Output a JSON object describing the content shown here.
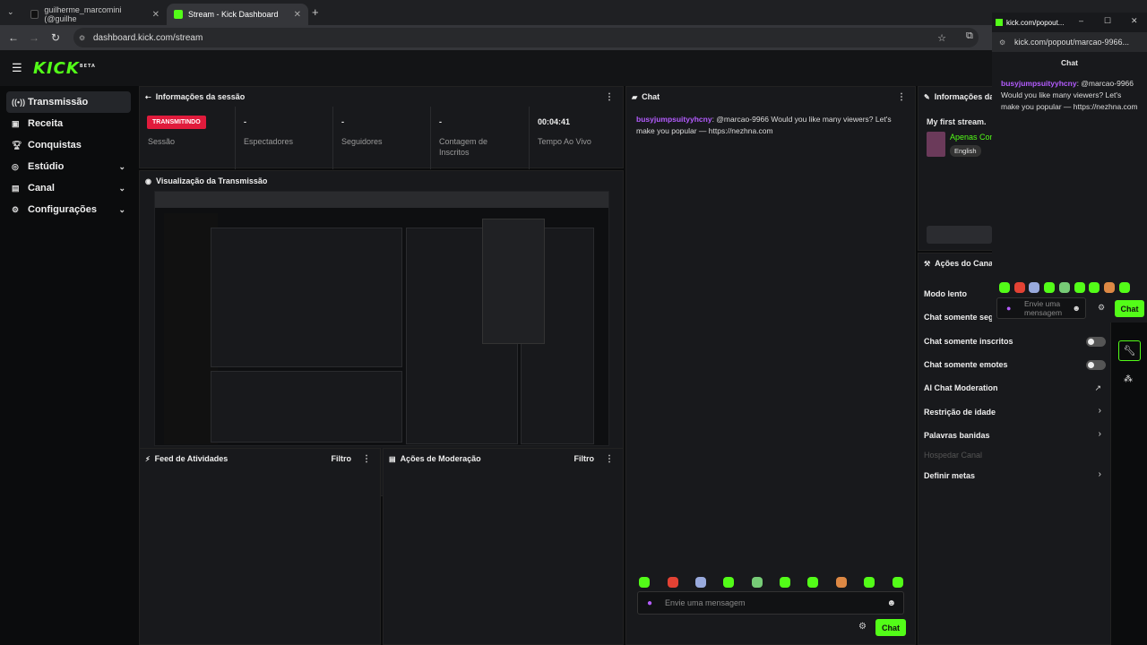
{
  "browser": {
    "tabs": [
      {
        "label": "guilherme_marcomini (@guilhe",
        "icon": "tiktok-icon"
      },
      {
        "label": "Stream - Kick Dashboard",
        "icon": "kick-icon"
      }
    ],
    "url": "dashboard.kick.com/stream"
  },
  "app": {
    "logo": "KICK",
    "logo_beta": "BETA"
  },
  "sidebar": {
    "items": [
      {
        "label": "Transmissão",
        "icon": "broadcast-icon",
        "active": true
      },
      {
        "label": "Receita",
        "icon": "revenue-icon"
      },
      {
        "label": "Conquistas",
        "icon": "trophy-icon"
      },
      {
        "label": "Estúdio",
        "icon": "studio-icon",
        "expandable": true
      },
      {
        "label": "Canal",
        "icon": "channel-icon",
        "expandable": true
      },
      {
        "label": "Configurações",
        "icon": "gear-icon",
        "expandable": true
      }
    ]
  },
  "session": {
    "title": "Informações da sessão",
    "status_badge": "TRANSMITINDO",
    "stats": [
      {
        "value": "",
        "label": "Sessão"
      },
      {
        "value": "-",
        "label": "Espectadores"
      },
      {
        "value": "-",
        "label": "Seguidores"
      },
      {
        "value": "-",
        "label": "Contagem de Inscritos"
      },
      {
        "value": "00:04:41",
        "label": "Tempo Ao Vivo"
      }
    ]
  },
  "preview": {
    "title": "Visualização da Transmissão"
  },
  "activity": {
    "title": "Feed de Atividades",
    "filter": "Filtro"
  },
  "moderation_actions": {
    "title": "Ações de Moderação",
    "filter": "Filtro"
  },
  "chat": {
    "title": "Chat",
    "messages": [
      {
        "user": "busyjumpsuityyhcny",
        "text": ": @marcao-9966 Would you like many viewers? Let's make you popular — https://nezhna.com"
      }
    ],
    "placeholder": "Envie uma mensagem",
    "send": "Chat"
  },
  "stream_info": {
    "title": "Informações da",
    "stream_title": "My first stream.",
    "category": "Apenas Con",
    "language": "English"
  },
  "channel_actions": {
    "title": "Ações do Canal",
    "rows": [
      {
        "label": "Modo lento",
        "kind": "toggle"
      },
      {
        "label": "Chat somente segu",
        "kind": "toggle"
      },
      {
        "label": "Chat somente inscritos",
        "kind": "toggle"
      },
      {
        "label": "Chat somente emotes",
        "kind": "toggle"
      },
      {
        "label": "AI Chat Moderation",
        "kind": "external"
      },
      {
        "label": "Restrição de idade",
        "kind": "arrow"
      },
      {
        "label": "Palavras banidas",
        "kind": "arrow"
      },
      {
        "label": "Hospedar Canal",
        "kind": "disabled"
      },
      {
        "label": "Definir metas",
        "kind": "arrow"
      }
    ]
  },
  "popout": {
    "tab_title": "kick.com/popout...",
    "url": "kick.com/popout/marcao-9966...",
    "header": "Chat",
    "message_user": "busyjumpsuityyhcny",
    "message_text": ": @marcao-9966 Would you like many viewers? Let's make you popular — https://nezhna.com",
    "placeholder": "Envie uma mensagem",
    "send": "Chat"
  },
  "colors": {
    "accent": "#53fc18",
    "live": "#e01b3c",
    "username": "#b45cff"
  }
}
